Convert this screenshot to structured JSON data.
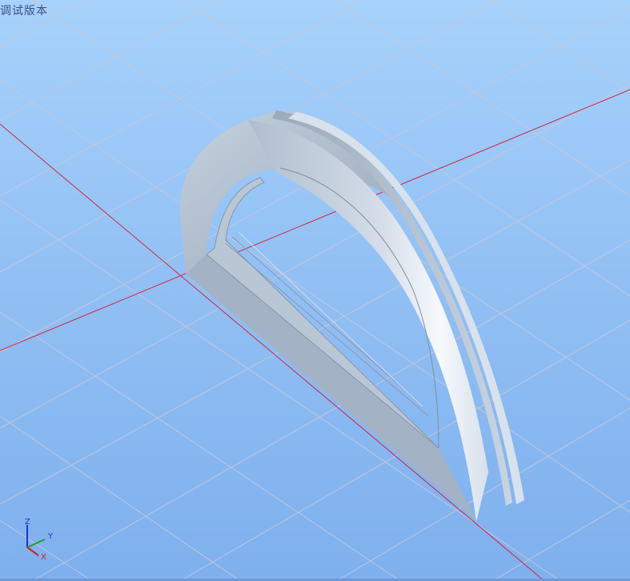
{
  "window": {
    "watermark_text": "调试版本"
  },
  "viewport": {
    "background_top": "#a6d2fb",
    "background_bottom": "#7eb0ee",
    "grid_color": "#c7c7d4",
    "axis_line_color": "#d4243c",
    "model_color": "#a9b8c9",
    "model": "half-ring-arch"
  },
  "axis_triad": {
    "z_label": "Z",
    "y_label": "Y",
    "x_label": "X",
    "z_color": "#2030d0",
    "y_color": "#20a020",
    "x_color": "#d02020"
  }
}
